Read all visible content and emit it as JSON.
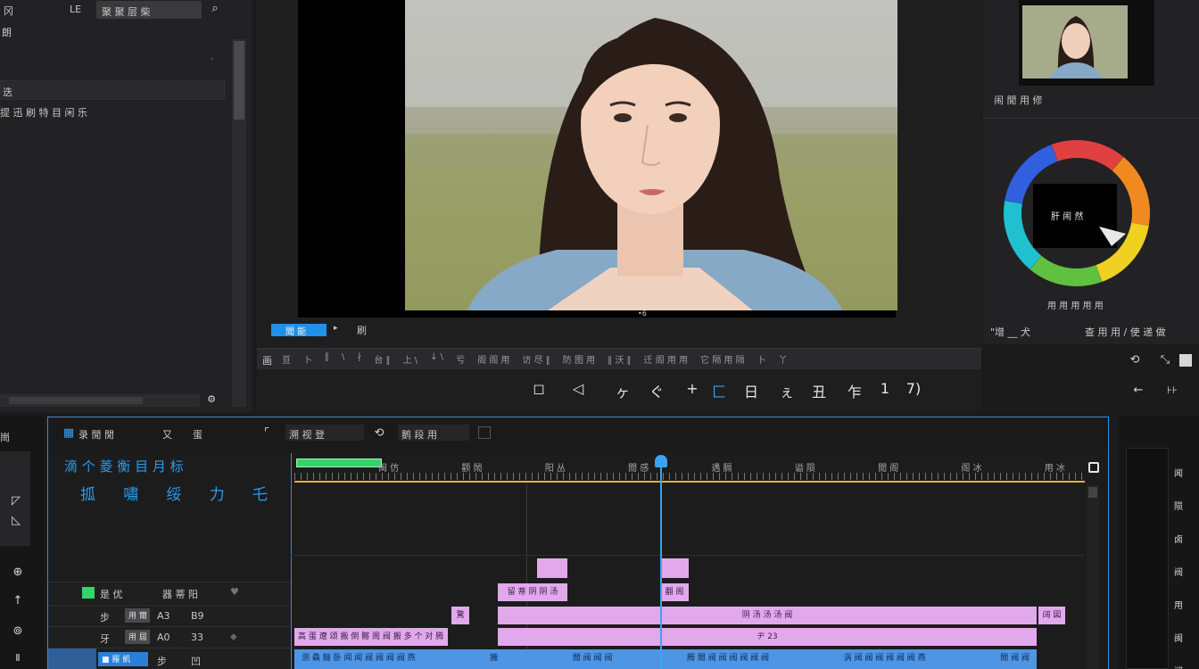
{
  "left_panel": {
    "tab1": "冈",
    "tab2": "LE",
    "search_field": "聚 聚 层 柴",
    "row1": "朗",
    "row2": "迭",
    "item": "提 迅   刷 特 目 闲 乐"
  },
  "preview": {
    "bottom_marker": "•6",
    "tab_active": "聞 能",
    "tab_other": "刷",
    "right_label_1": "\"增 __ 犬",
    "right_label_2": "查 用 用  /  使 递 做"
  },
  "scopes": {
    "thumb_label": "闹 閒 用 修",
    "wheel_center_text": "肝 闹 然",
    "wheel_caption": "用 用 用 用 用"
  },
  "transport": {
    "ruler_labels": [
      "亘",
      "卜",
      "∥",
      "\\",
      "∤",
      "台 ∥",
      "上 \\",
      "↓ \\",
      "亏",
      "阁 阁 用",
      "访 尽 ∥",
      "防 图 用",
      "∥ 沃 ∥",
      "迁 阁 用 用",
      "它 隔 用 隔",
      "卜",
      "丫"
    ],
    "controls": [
      "◻",
      "◁",
      "ヶ",
      "ぐ",
      "+",
      "匚",
      "日",
      "ぇ",
      "丑",
      "乍",
      "1",
      "7)"
    ],
    "right_controls": [
      "←",
      "⊦⊦"
    ]
  },
  "timeline": {
    "header_title": "录 閒 閒",
    "header_t2": "又",
    "header_t3": "蛋",
    "header_f1": "溯 视 登",
    "header_f2": "鹅 段 用",
    "big_title": "滴 个 菱 衡 目 月 标",
    "big_subtitle": [
      "㧓",
      "嘯",
      "绥",
      "力",
      "乇"
    ],
    "ruler_labels": [
      "闽 仿",
      "颧 鬧",
      "阳 丛",
      "閲 感",
      "遇 膈",
      "谥 陨",
      "閲 阁",
      "阁 冰",
      "用 冰"
    ],
    "tracks": [
      {
        "label_a": "是 优",
        "label_b": "器 蒂 阳",
        "icon": "♥"
      },
      {
        "label_a": "步",
        "label_b": "用 爾",
        "label_c": "A3",
        "label_d": "B9"
      },
      {
        "label_a": "牙",
        "label_b": "用 屆",
        "label_c": "A0",
        "label_d": "33"
      },
      {
        "label_a": "■ 羅 凱",
        "label_b": "步",
        "label_c": "凹"
      }
    ],
    "clips": {
      "c1": "留 蒂 阴 阴 汤",
      "c2": "翻 阁",
      "c3": "驚",
      "c4": "阴 汤 汤 汤 阀",
      "c5": "阔 図",
      "c6": "高 蛋 遼 颂 搬 倒 髂 阁 阀 搬 多 个 对 腾",
      "c7": "ヂ 23",
      "c8": "测 驫 鲡 卧 闻 闻 阀 阀 阀 阀 燕",
      "c9": "搬",
      "c10": "閲 阀 阀 阀",
      "c11": "腾 閲 阀 阀 阀 阀 阀 阀",
      "c12": "涡 阀 阀 阀 阀 阀 阀 燕",
      "c13": "閲 阀 阀"
    }
  },
  "right_panel": {
    "items": [
      "闻",
      "陨",
      "卤",
      "阀",
      "用",
      "闽",
      "阀"
    ]
  },
  "colors": {
    "accent_blue": "#2a9cf0",
    "clip_pink": "#e2a8ec",
    "clip_blue": "#4f95e6",
    "ruler_yellow": "#e0b43a",
    "green_bar": "#35d46a"
  }
}
